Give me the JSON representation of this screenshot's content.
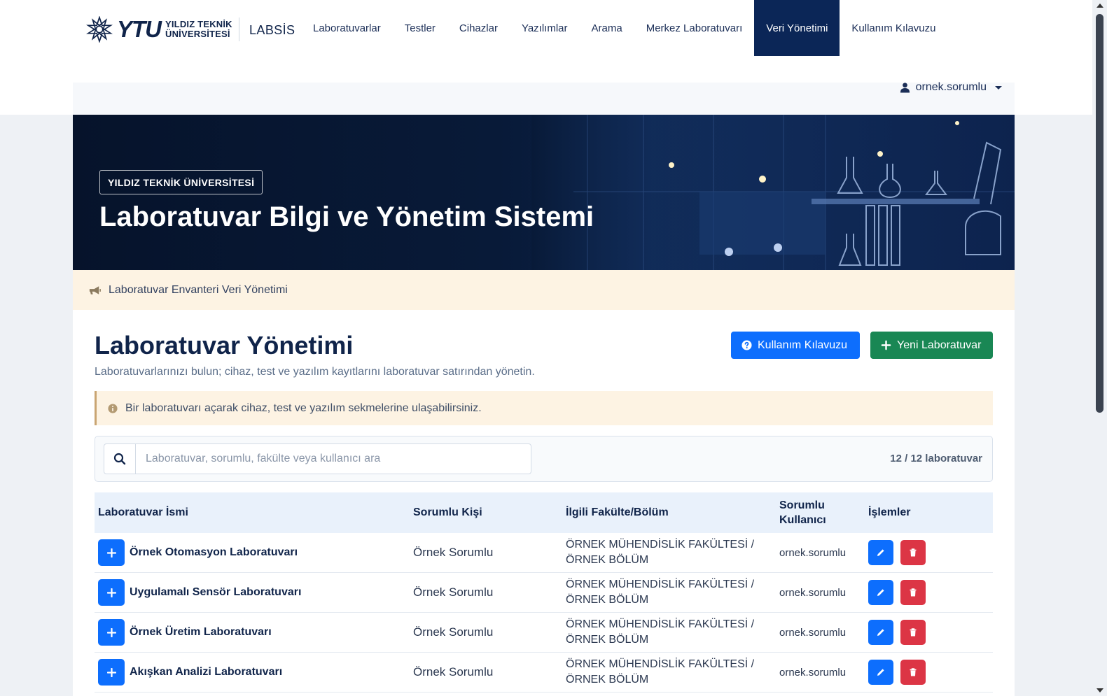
{
  "brand": {
    "logo_text": "YTU",
    "logo_line1": "YILDIZ TEKNİK",
    "logo_line2": "ÜNİVERSİTESİ",
    "app_name": "LABSİS"
  },
  "nav": {
    "items": [
      {
        "label": "Laboratuvarlar"
      },
      {
        "label": "Testler"
      },
      {
        "label": "Cihazlar"
      },
      {
        "label": "Yazılımlar"
      },
      {
        "label": "Arama"
      },
      {
        "label": "Merkez Laboratuvarı"
      },
      {
        "label": "Veri Yönetimi",
        "active": true
      },
      {
        "label": "Kullanım Kılavuzu"
      }
    ]
  },
  "user": {
    "username": "ornek.sorumlu",
    "icon": "user-icon"
  },
  "hero": {
    "tag": "YILDIZ TEKNİK ÜNİVERSİTESİ",
    "title": "Laboratuvar Bilgi ve Yönetim Sistemi"
  },
  "announcement": {
    "icon": "megaphone-icon",
    "text": "Laboratuvar Envanteri Veri Yönetimi"
  },
  "page": {
    "title": "Laboratuvar Yönetimi",
    "subtitle": "Laboratuvarlarınızı bulun; cihaz, test ve yazılım kayıtlarını laboratuvar satırından yönetin.",
    "help_button": "Kullanım Kılavuzu",
    "new_button": "Yeni Laboratuvar",
    "info_text": "Bir laboratuvarı açarak cihaz, test ve yazılım sekmelerine ulaşabilirsiniz."
  },
  "search": {
    "placeholder": "Laboratuvar, sorumlu, fakülte veya kullanıcı ara",
    "value": "",
    "count_text": "12 / 12 laboratuvar"
  },
  "table": {
    "headers": {
      "name": "Laboratuvar İsmi",
      "person": "Sorumlu Kişi",
      "faculty": "İlgili Fakülte/Bölüm",
      "user_line1": "Sorumlu",
      "user_line2": "Kullanıcı",
      "actions": "İşlemler"
    },
    "rows": [
      {
        "name": "Örnek Otomasyon Laboratuvarı",
        "person": "Örnek Sorumlu",
        "faculty_line1": "ÖRNEK MÜHENDİSLİK FAKÜLTESİ /",
        "faculty_line2": "ÖRNEK BÖLÜM",
        "user": "ornek.sorumlu"
      },
      {
        "name": "Uygulamalı Sensör Laboratuvarı",
        "person": "Örnek Sorumlu",
        "faculty_line1": "ÖRNEK MÜHENDİSLİK FAKÜLTESİ /",
        "faculty_line2": "ÖRNEK BÖLÜM",
        "user": "ornek.sorumlu"
      },
      {
        "name": "Örnek Üretim Laboratuvarı",
        "person": "Örnek Sorumlu",
        "faculty_line1": "ÖRNEK MÜHENDİSLİK FAKÜLTESİ /",
        "faculty_line2": "ÖRNEK BÖLÜM",
        "user": "ornek.sorumlu"
      },
      {
        "name": "Akışkan Analizi Laboratuvarı",
        "person": "Örnek Sorumlu",
        "faculty_line1": "ÖRNEK MÜHENDİSLİK FAKÜLTESİ /",
        "faculty_line2": "ÖRNEK BÖLÜM",
        "user": "ornek.sorumlu"
      }
    ]
  },
  "colors": {
    "nav_active": "#0b2657",
    "primary": "#0d6efd",
    "success": "#198754",
    "danger": "#dc3545",
    "announcement_bg": "#fdf3e3"
  }
}
